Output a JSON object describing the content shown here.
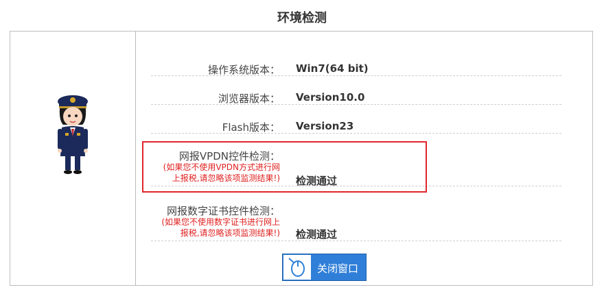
{
  "page": {
    "title": "环境检测"
  },
  "rows": [
    {
      "label": "操作系统版本：",
      "value": "Win7(64 bit)"
    },
    {
      "label": "浏览器版本：",
      "value": "Version10.0"
    },
    {
      "label": "Flash版本：",
      "value": "Version23"
    },
    {
      "label": "网报VPDN控件检测：",
      "note1": "(如果您不使用VPDN方式进行网",
      "note2": "上报税,请忽略该项监测结果!)",
      "value": "检测通过"
    },
    {
      "label": "网报数字证书控件检测：",
      "note1": "(如果您不使用数字证书进行网上",
      "note2": "报税,请忽略该项监测结果!)",
      "value": "检测通过"
    }
  ],
  "actions": {
    "close_label": "关闭窗口"
  },
  "colors": {
    "accent": "#2f7fd9",
    "highlight": "#e0262b",
    "note": "#e02020"
  }
}
